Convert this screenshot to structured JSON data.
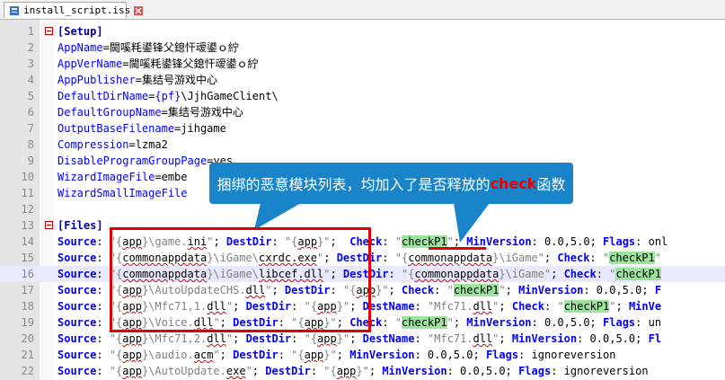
{
  "tab": {
    "label": "install_script.iss"
  },
  "callout": {
    "text_before": "捆绑的恶意模块列表，均加入了是否释放的",
    "text_highlight": "check",
    "text_after": "函数"
  },
  "lines": [
    {
      "n": "1",
      "fold": "start",
      "segs": [
        [
          "sec",
          "[Setup]"
        ]
      ]
    },
    {
      "n": "2",
      "segs": [
        [
          "key",
          "AppName"
        ],
        [
          "eq",
          "="
        ],
        [
          "val",
          "閫嗘粍鍙锋父鎴忓叆鍙ｏ紵"
        ]
      ]
    },
    {
      "n": "3",
      "segs": [
        [
          "key",
          "AppVerName"
        ],
        [
          "eq",
          "="
        ],
        [
          "val",
          "閫嗘粍鍙锋父鎴忓叆鍙ｏ紵"
        ]
      ]
    },
    {
      "n": "4",
      "segs": [
        [
          "key",
          "AppPublisher"
        ],
        [
          "eq",
          "="
        ],
        [
          "val",
          "集结号游戏中心"
        ]
      ]
    },
    {
      "n": "5",
      "segs": [
        [
          "key",
          "DefaultDirName"
        ],
        [
          "eq",
          "="
        ],
        [
          "key",
          "{pf}"
        ],
        [
          "val",
          "\\JjhGameClient\\"
        ]
      ]
    },
    {
      "n": "6",
      "segs": [
        [
          "key",
          "DefaultGroupName"
        ],
        [
          "eq",
          "="
        ],
        [
          "val",
          "集结号游戏中心"
        ]
      ]
    },
    {
      "n": "7",
      "segs": [
        [
          "key",
          "OutputBaseFilename"
        ],
        [
          "eq",
          "="
        ],
        [
          "val",
          "jihgame"
        ]
      ]
    },
    {
      "n": "8",
      "segs": [
        [
          "key",
          "Compression"
        ],
        [
          "eq",
          "="
        ],
        [
          "val",
          "lzma2"
        ]
      ]
    },
    {
      "n": "9",
      "segs": [
        [
          "key",
          "DisableProgramGroupPage"
        ],
        [
          "eq",
          "="
        ],
        [
          "val",
          "yes"
        ]
      ]
    },
    {
      "n": "10",
      "segs": [
        [
          "key",
          "WizardImageFile"
        ],
        [
          "eq",
          "="
        ],
        [
          "val",
          "embe"
        ]
      ]
    },
    {
      "n": "11",
      "segs": [
        [
          "key",
          "WizardSmallImageFile"
        ]
      ]
    },
    {
      "n": "12",
      "segs": []
    },
    {
      "n": "13",
      "fold": "start",
      "segs": [
        [
          "sec",
          "[Files]"
        ]
      ]
    },
    {
      "n": "14",
      "segs": [
        [
          "kw",
          "Source"
        ],
        [
          "eq",
          ": "
        ],
        [
          "str",
          "\"{"
        ],
        [
          "sq",
          "app"
        ],
        [
          "str",
          "}\\game."
        ],
        [
          "sq",
          "ini"
        ],
        [
          "str",
          "\""
        ],
        [
          "eq",
          "; "
        ],
        [
          "kw",
          "DestDir"
        ],
        [
          "eq",
          ": "
        ],
        [
          "str",
          "\"{"
        ],
        [
          "sq",
          "app"
        ],
        [
          "str",
          "}\""
        ],
        [
          "eq",
          ";  "
        ],
        [
          "kw",
          "Check"
        ],
        [
          "eq",
          ": "
        ],
        [
          "str",
          "\""
        ],
        [
          "chk",
          "checkP1"
        ],
        [
          "str",
          "\""
        ],
        [
          "eq",
          "; "
        ],
        [
          "kw",
          "MinVersion"
        ],
        [
          "eq",
          ": 0.0,5.0; "
        ],
        [
          "kw",
          "Flags"
        ],
        [
          "eq",
          ": onl"
        ]
      ]
    },
    {
      "n": "15",
      "segs": [
        [
          "kw",
          "Source"
        ],
        [
          "eq",
          ": "
        ],
        [
          "str",
          "\"{"
        ],
        [
          "sq",
          "commonappdata"
        ],
        [
          "str",
          "}\\iGame\\"
        ],
        [
          "sq",
          "cxrdc.exe"
        ],
        [
          "str",
          "\""
        ],
        [
          "eq",
          "; "
        ],
        [
          "kw",
          "DestDir"
        ],
        [
          "eq",
          ": "
        ],
        [
          "str",
          "\"{"
        ],
        [
          "sq",
          "commonappdata"
        ],
        [
          "str",
          "}\\iGame\""
        ],
        [
          "eq",
          "; "
        ],
        [
          "kw",
          "Check"
        ],
        [
          "eq",
          ": "
        ],
        [
          "str",
          "\""
        ],
        [
          "chk",
          "checkP1"
        ],
        [
          "str",
          "\""
        ]
      ]
    },
    {
      "n": "16",
      "hl": true,
      "segs": [
        [
          "kw",
          "Source"
        ],
        [
          "eq",
          ": "
        ],
        [
          "str",
          "\"{"
        ],
        [
          "sq",
          "commonappdata"
        ],
        [
          "str",
          "}\\iGame\\"
        ],
        [
          "sq",
          "libcef.dll"
        ],
        [
          "str",
          "\""
        ],
        [
          "eq",
          "; "
        ],
        [
          "kw",
          "DestDir"
        ],
        [
          "eq",
          ": "
        ],
        [
          "str",
          "\"{"
        ],
        [
          "sq",
          "commonappdata"
        ],
        [
          "str",
          "}\\iGame\""
        ],
        [
          "eq",
          "; "
        ],
        [
          "kw",
          "Check"
        ],
        [
          "eq",
          ": "
        ],
        [
          "str",
          "\""
        ],
        [
          "chk",
          "checkP1"
        ]
      ]
    },
    {
      "n": "17",
      "segs": [
        [
          "kw",
          "Source"
        ],
        [
          "eq",
          ": "
        ],
        [
          "str",
          "\"{"
        ],
        [
          "sq",
          "app"
        ],
        [
          "str",
          "}\\AutoUpdateCHS."
        ],
        [
          "sq",
          "dll"
        ],
        [
          "str",
          "\""
        ],
        [
          "eq",
          "; "
        ],
        [
          "kw",
          "DestDir"
        ],
        [
          "eq",
          ": "
        ],
        [
          "str",
          "\"{"
        ],
        [
          "sq",
          "app"
        ],
        [
          "str",
          "}\""
        ],
        [
          "eq",
          "; "
        ],
        [
          "kw",
          "Check"
        ],
        [
          "eq",
          ": "
        ],
        [
          "str",
          "\""
        ],
        [
          "chk",
          "checkP1"
        ],
        [
          "str",
          "\""
        ],
        [
          "eq",
          "; "
        ],
        [
          "kw",
          "MinVersion"
        ],
        [
          "eq",
          ": 0.0,5.0; "
        ],
        [
          "kw",
          "F"
        ]
      ]
    },
    {
      "n": "18",
      "segs": [
        [
          "kw",
          "Source"
        ],
        [
          "eq",
          ": "
        ],
        [
          "str",
          "\"{"
        ],
        [
          "sq",
          "app"
        ],
        [
          "str",
          "}\\Mfc71,1."
        ],
        [
          "sq",
          "dll"
        ],
        [
          "str",
          "\""
        ],
        [
          "eq",
          "; "
        ],
        [
          "kw",
          "DestDir"
        ],
        [
          "eq",
          ": "
        ],
        [
          "str",
          "\"{"
        ],
        [
          "sq",
          "app"
        ],
        [
          "str",
          "}\""
        ],
        [
          "eq",
          "; "
        ],
        [
          "kw",
          "DestName"
        ],
        [
          "eq",
          ": "
        ],
        [
          "str",
          "\"Mfc71."
        ],
        [
          "sq",
          "dll"
        ],
        [
          "str",
          "\""
        ],
        [
          "eq",
          "; "
        ],
        [
          "kw",
          "Check"
        ],
        [
          "eq",
          ": "
        ],
        [
          "str",
          "\""
        ],
        [
          "chk",
          "checkP1"
        ],
        [
          "str",
          "\""
        ],
        [
          "eq",
          "; "
        ],
        [
          "kw",
          "MinVe"
        ]
      ]
    },
    {
      "n": "19",
      "segs": [
        [
          "kw",
          "Source"
        ],
        [
          "eq",
          ": "
        ],
        [
          "str",
          "\"{"
        ],
        [
          "sq",
          "app"
        ],
        [
          "str",
          "}\\Voice."
        ],
        [
          "sq",
          "dll"
        ],
        [
          "str",
          "\""
        ],
        [
          "eq",
          "; "
        ],
        [
          "kw",
          "DestDir"
        ],
        [
          "eq",
          ": "
        ],
        [
          "str",
          "\"{"
        ],
        [
          "sq",
          "app"
        ],
        [
          "str",
          "}\""
        ],
        [
          "eq",
          "; "
        ],
        [
          "kw",
          "Check"
        ],
        [
          "eq",
          ": "
        ],
        [
          "str",
          "\""
        ],
        [
          "chk",
          "checkP1"
        ],
        [
          "str",
          "\""
        ],
        [
          "eq",
          "; "
        ],
        [
          "kw",
          "MinVersion"
        ],
        [
          "eq",
          ": 0.0,5.0; "
        ],
        [
          "kw",
          "Flags"
        ],
        [
          "eq",
          ": un"
        ]
      ]
    },
    {
      "n": "20",
      "segs": [
        [
          "kw",
          "Source"
        ],
        [
          "eq",
          ": "
        ],
        [
          "str",
          "\"{"
        ],
        [
          "sq",
          "app"
        ],
        [
          "str",
          "}\\Mfc71,2."
        ],
        [
          "sq",
          "dll"
        ],
        [
          "str",
          "\""
        ],
        [
          "eq",
          "; "
        ],
        [
          "kw",
          "DestDir"
        ],
        [
          "eq",
          ": "
        ],
        [
          "str",
          "\"{"
        ],
        [
          "sq",
          "app"
        ],
        [
          "str",
          "}\""
        ],
        [
          "eq",
          "; "
        ],
        [
          "kw",
          "DestName"
        ],
        [
          "eq",
          ": "
        ],
        [
          "str",
          "\"Mfc71."
        ],
        [
          "sq",
          "dll"
        ],
        [
          "str",
          "\""
        ],
        [
          "eq",
          "; "
        ],
        [
          "kw",
          "MinVersion"
        ],
        [
          "eq",
          ": 0.0,5.0; "
        ],
        [
          "kw",
          "Fl"
        ]
      ]
    },
    {
      "n": "21",
      "segs": [
        [
          "kw",
          "Source"
        ],
        [
          "eq",
          ": "
        ],
        [
          "str",
          "\"{"
        ],
        [
          "sq",
          "app"
        ],
        [
          "str",
          "}\\audio."
        ],
        [
          "sq",
          "acm"
        ],
        [
          "str",
          "\""
        ],
        [
          "eq",
          "; "
        ],
        [
          "kw",
          "DestDir"
        ],
        [
          "eq",
          ": "
        ],
        [
          "str",
          "\"{"
        ],
        [
          "sq",
          "app"
        ],
        [
          "str",
          "}\""
        ],
        [
          "eq",
          "; "
        ],
        [
          "kw",
          "MinVersion"
        ],
        [
          "eq",
          ": 0.0,5.0; "
        ],
        [
          "kw",
          "Flags"
        ],
        [
          "eq",
          ": ignoreversion"
        ]
      ]
    },
    {
      "n": "22",
      "segs": [
        [
          "kw",
          "Source"
        ],
        [
          "eq",
          ": "
        ],
        [
          "str",
          "\"{"
        ],
        [
          "sq",
          "app"
        ],
        [
          "str",
          "}\\AutoUpdate."
        ],
        [
          "sq",
          "exe"
        ],
        [
          "str",
          "\""
        ],
        [
          "eq",
          "; "
        ],
        [
          "kw",
          "DestDir"
        ],
        [
          "eq",
          ": "
        ],
        [
          "str",
          "\"{"
        ],
        [
          "sq",
          "app"
        ],
        [
          "str",
          "}\""
        ],
        [
          "eq",
          "; "
        ],
        [
          "kw",
          "MinVersion"
        ],
        [
          "eq",
          ": 0.0,5.0; "
        ],
        [
          "kw",
          "Flags"
        ],
        [
          "eq",
          ": ignoreversion"
        ]
      ]
    }
  ]
}
